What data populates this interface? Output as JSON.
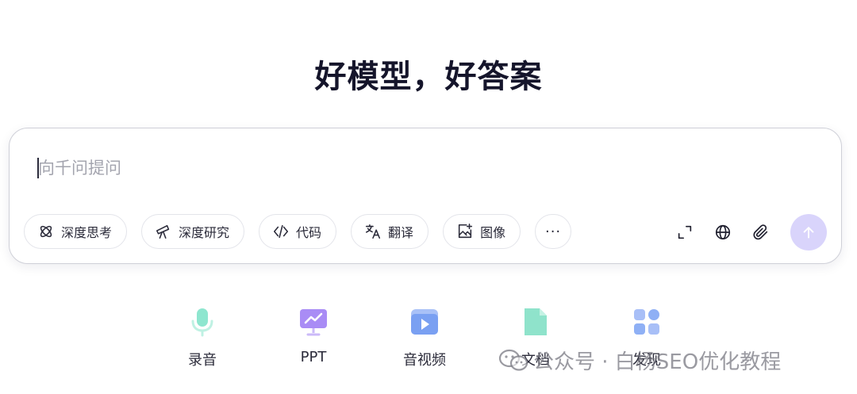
{
  "headline": "好模型，好答案",
  "input": {
    "placeholder": "向千问提问"
  },
  "chips": {
    "deep_think": "深度思考",
    "deep_research": "深度研究",
    "code": "代码",
    "translate": "翻译",
    "image": "图像",
    "more": "···"
  },
  "shortcuts": {
    "record": "录音",
    "ppt": "PPT",
    "audio_video": "音视频",
    "document": "文档",
    "discover": "发现"
  },
  "watermark": "公众号 · 白杨SEO优化教程",
  "colors": {
    "send_button": "#d9d4fb",
    "record_icon": "#8ee6cf",
    "ppt_icon": "#a98cf5",
    "audio_video_icon": "#7aa0f2",
    "document_icon": "#8fe3cb",
    "discover_icon": "#8fb0f5"
  }
}
